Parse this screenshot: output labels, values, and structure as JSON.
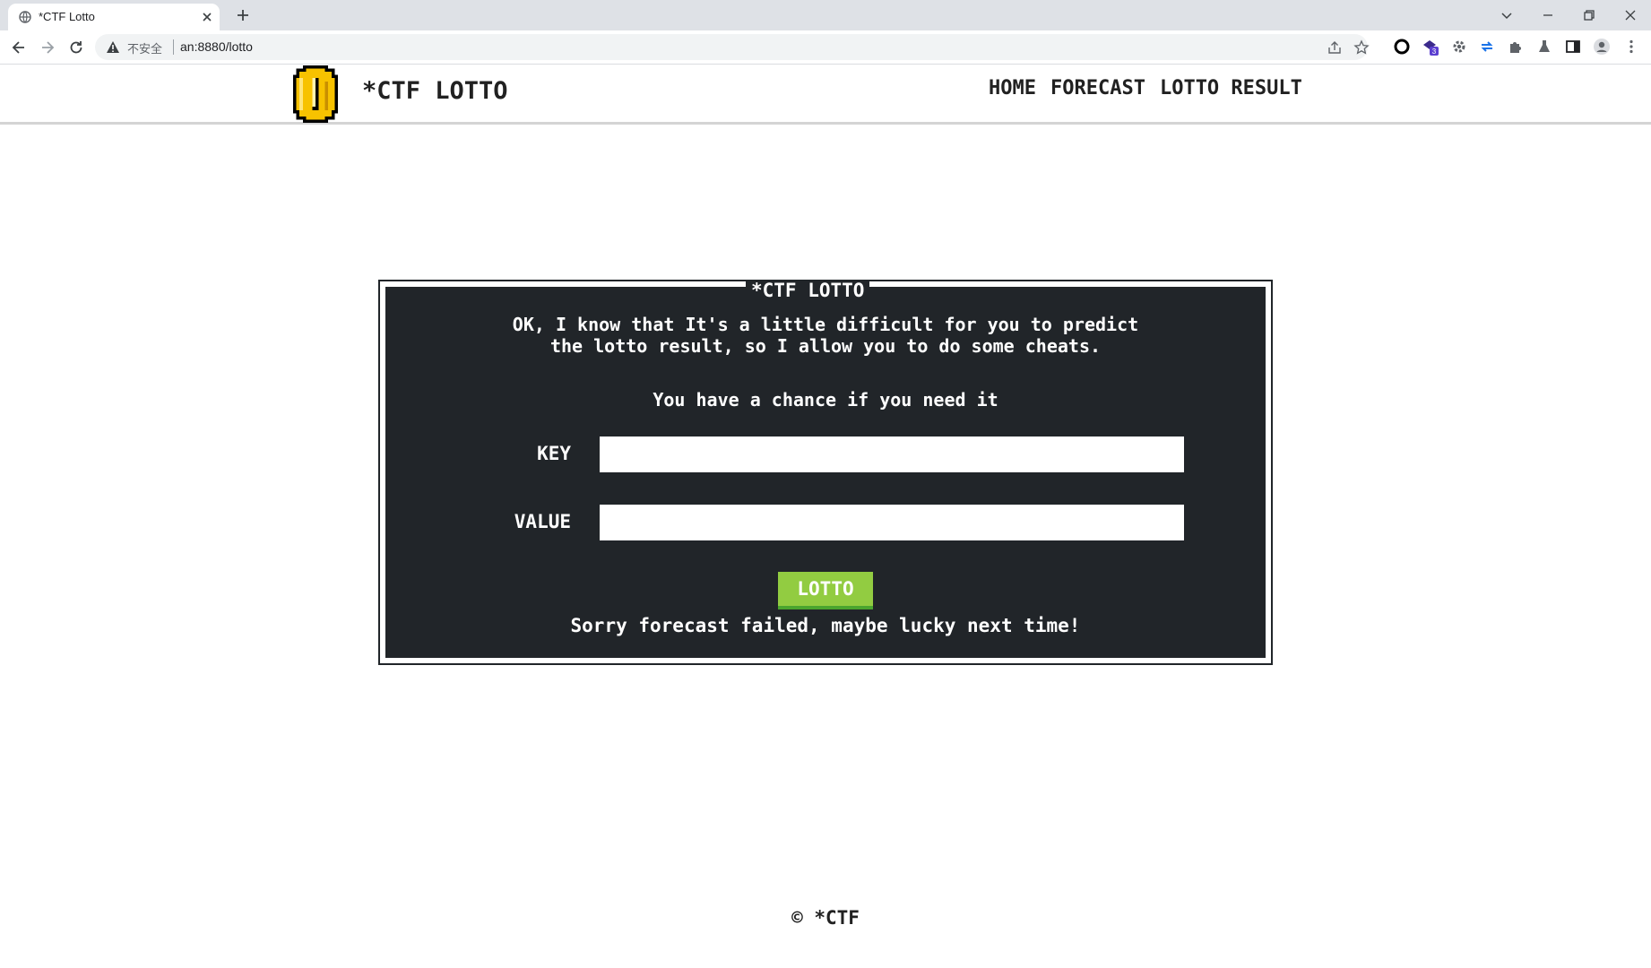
{
  "browser": {
    "tab_title": "*CTF Lotto",
    "insecure_label": "不安全",
    "url": "an:8880/lotto",
    "extension_badge": "3"
  },
  "site": {
    "brand": "*CTF LOTTO",
    "nav": [
      "HOME",
      "FORECAST",
      "LOTTO RESULT"
    ]
  },
  "panel": {
    "title": "*CTF LOTTO",
    "message_line1": "OK, I know that It's a little difficult for you to predict",
    "message_line2": "the lotto result, so I allow you to do some cheats.",
    "chance": "You have a chance if you need it",
    "key_label": "KEY",
    "key_value": "",
    "value_label": "VALUE",
    "value_value": "",
    "button": "LOTTO",
    "result": "Sorry forecast failed, maybe lucky next time!"
  },
  "footer": "© *CTF",
  "colors": {
    "panel_bg": "#212529",
    "button_green": "#92cc41",
    "button_shadow": "#4aa52e",
    "coin_gold": "#f7c200"
  },
  "icons": [
    "globe-icon",
    "close-icon",
    "plus-icon",
    "chevron-down-icon",
    "minimize-icon",
    "restore-icon",
    "back-icon",
    "forward-icon",
    "reload-icon",
    "warning-icon",
    "share-icon",
    "star-icon",
    "puzzle-icon",
    "profile-icon",
    "menu-icon",
    "coin-icon"
  ]
}
